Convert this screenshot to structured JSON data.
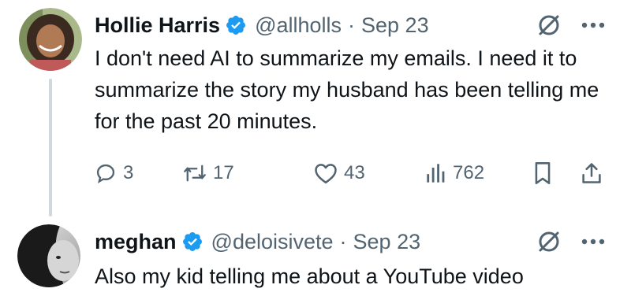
{
  "tweets": [
    {
      "display_name": "Hollie Harris",
      "handle": "@allholls",
      "separator": "·",
      "date": "Sep 23",
      "text": "I don't need AI to summarize my emails. I need it to summarize the story my husband has been telling me for the past 20 minutes.",
      "replies": "3",
      "retweets": "17",
      "likes": "43",
      "views": "762",
      "verified": true
    },
    {
      "display_name": "meghan",
      "handle": "@deloisivete",
      "separator": "·",
      "date": "Sep 23",
      "text": "Also my kid telling me about a YouTube video",
      "verified": true
    }
  ],
  "icons": {
    "verified": "verified-badge-icon",
    "grok": "grok-icon",
    "more": "more-icon",
    "reply": "reply-icon",
    "retweet": "retweet-icon",
    "like": "heart-icon",
    "views": "views-icon",
    "bookmark": "bookmark-icon",
    "share": "share-icon"
  },
  "colors": {
    "verified_blue": "#1d9bf0",
    "secondary_text": "#536471",
    "primary_text": "#0f1419",
    "thread_line": "#cfd9de"
  }
}
